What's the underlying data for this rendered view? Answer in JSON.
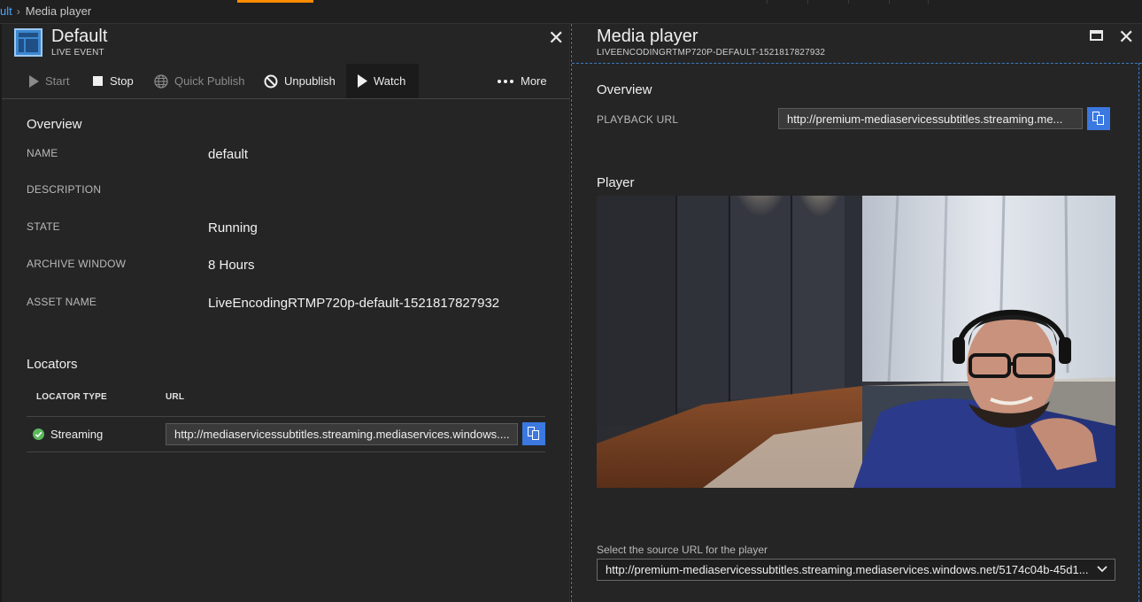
{
  "breadcrumb": {
    "parent": "ult",
    "current": "Media player"
  },
  "left_blade": {
    "title": "Default",
    "subtitle": "LIVE EVENT",
    "toolbar": {
      "start": "Start",
      "stop": "Stop",
      "quick_publish": "Quick Publish",
      "unpublish": "Unpublish",
      "watch": "Watch",
      "more": "More"
    },
    "overview": {
      "heading": "Overview",
      "name_label": "NAME",
      "name_value": "default",
      "description_label": "DESCRIPTION",
      "state_label": "STATE",
      "state_value": "Running",
      "archive_label": "ARCHIVE WINDOW",
      "archive_value": "8 Hours",
      "asset_label": "ASSET NAME",
      "asset_value": "LiveEncodingRTMP720p-default-1521817827932"
    },
    "locators": {
      "heading": "Locators",
      "col_type": "LOCATOR TYPE",
      "col_url": "URL",
      "rows": [
        {
          "type": "Streaming",
          "url": "http://mediaservicessubtitles.streaming.mediaservices.windows...."
        }
      ]
    }
  },
  "right_blade": {
    "title": "Media player",
    "subtitle": "LIVEENCODINGRTMP720P-DEFAULT-1521817827932",
    "overview_heading": "Overview",
    "playback_label": "PLAYBACK URL",
    "playback_url": "http://premium-mediaservicessubtitles.streaming.me...",
    "player_heading": "Player",
    "source_caption": "Select the source URL for the player",
    "source_selected": "http://premium-mediaservicessubtitles.streaming.mediaservices.windows.net/5174c04b-45d1..."
  },
  "colors": {
    "accent": "#ff8c00",
    "link": "#4aa3ff",
    "copy_button": "#3b78e0",
    "success": "#5cb85c"
  }
}
